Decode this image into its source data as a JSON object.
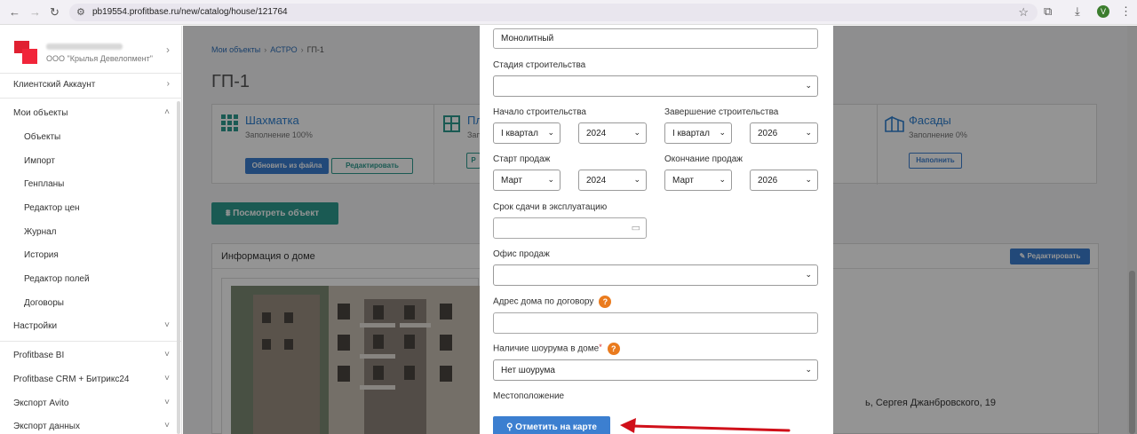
{
  "browser": {
    "back_icon": "arrow-left-icon",
    "forward_icon": "arrow-right-icon",
    "reload_icon": "reload-icon",
    "url": "pb19554.profitbase.ru/new/catalog/house/121764",
    "avatar_letter": "V"
  },
  "sidebar": {
    "org_name": "ООО \"Крылья Девелопмент\"",
    "client_account": "Клиентский Аккаунт",
    "my_objects": "Мои объекты",
    "sub_items": [
      "Объекты",
      "Импорт",
      "Генпланы",
      "Редактор цен",
      "Журнал",
      "История",
      "Редактор полей",
      "Договоры"
    ],
    "settings": "Настройки",
    "sections": [
      "Profitbase BI",
      "Profitbase CRM + Битрикс24",
      "Экспорт Avito",
      "Экспорт данных"
    ]
  },
  "main": {
    "breadcrumb": [
      "Мои объекты",
      "АСТРО",
      "ГП-1"
    ],
    "page_title": "ГП-1",
    "chess": {
      "title": "Шахматка",
      "fill": "Заполнение 100%",
      "update_btn": "Обновить из файла",
      "edit_btn": "Редактировать"
    },
    "plans": {
      "title": "Пл",
      "fill": "Запо",
      "btn": "Р"
    },
    "facades": {
      "title": "Фасады",
      "fill": "Заполнение 0%",
      "btn": "Наполнить"
    },
    "view_btn": "Посмотреть объект",
    "info_title": "Информация о доме",
    "info_edit_btn": "Редактировать",
    "address_tail": "ь, Сергея Джанбровского, 19"
  },
  "modal": {
    "material_value": "Монолитный",
    "stage_label": "Стадия строительства",
    "stage_value": "",
    "build_start_label": "Начало строительства",
    "build_start_quarter": "I квартал",
    "build_start_year": "2024",
    "build_end_label": "Завершение строительства",
    "build_end_quarter": "I квартал",
    "build_end_year": "2026",
    "sales_start_label": "Старт продаж",
    "sales_start_month": "Март",
    "sales_start_year": "2024",
    "sales_end_label": "Окончание продаж",
    "sales_end_month": "Март",
    "sales_end_year": "2026",
    "commission_label": "Срок сдачи в эксплуатацию",
    "commission_value": "",
    "office_label": "Офис продаж",
    "office_value": "",
    "contract_address_label": "Адрес дома по договору",
    "contract_address_value": "",
    "showroom_label": "Наличие шоурума в доме",
    "showroom_value": "Нет шоурума",
    "location_label": "Местоположение",
    "map_btn": "Отметить на карте"
  },
  "colors": {
    "accent_blue": "#3c7fd0",
    "teal": "#2e9b8f",
    "help_orange": "#ea7b1e",
    "arrow_red": "#d0101a"
  }
}
